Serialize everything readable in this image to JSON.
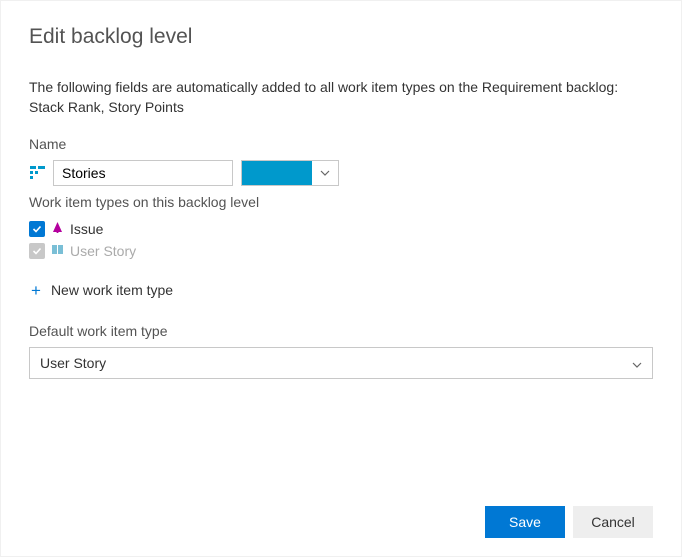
{
  "dialog": {
    "title": "Edit backlog level",
    "info": "The following fields are automatically added to all work item types on the Requirement backlog: Stack Rank, Story Points"
  },
  "name_section": {
    "label": "Name",
    "value": "Stories",
    "color": "#0099cc"
  },
  "wit_section": {
    "label": "Work item types on this backlog level",
    "items": [
      {
        "label": "Issue",
        "checked": true,
        "disabled": false,
        "icon": "issue"
      },
      {
        "label": "User Story",
        "checked": true,
        "disabled": true,
        "icon": "story"
      }
    ],
    "new_label": "New work item type"
  },
  "default_section": {
    "label": "Default work item type",
    "value": "User Story"
  },
  "footer": {
    "save": "Save",
    "cancel": "Cancel"
  }
}
